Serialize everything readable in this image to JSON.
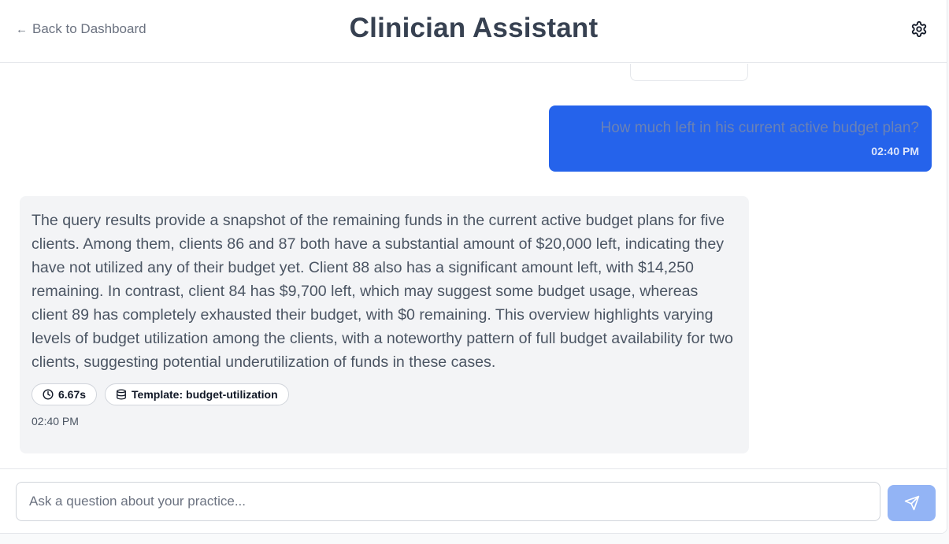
{
  "header": {
    "back_label": "Back to Dashboard",
    "back_arrow": "←",
    "title": "Clinician Assistant",
    "settings_icon": "gear-icon"
  },
  "messages": [
    {
      "role": "user",
      "text": "How much left in his current active budget plan?",
      "time": "02:40 PM"
    },
    {
      "role": "assistant",
      "text": "The query results provide a snapshot of the remaining funds in the current active budget plans for five clients. Among them, clients 86 and 87 both have a substantial amount of $20,000 left, indicating they have not utilized any of their budget yet. Client 88 also has a significant amount left, with $14,250 remaining. In contrast, client 84 has $9,700 left, which may suggest some budget usage, whereas client 89 has completely exhausted their budget, with $0 remaining. This overview highlights varying levels of budget utilization among the clients, with a noteworthy pattern of full budget availability for two clients, suggesting potential underutilization of funds in these cases.",
      "duration": "6.67s",
      "template": "Template: budget-utilization",
      "time": "02:40 PM"
    }
  ],
  "composer": {
    "placeholder": "Ask a question about your practice...",
    "value": "",
    "send_icon": "send-icon"
  },
  "colors": {
    "user_bubble": "#2563eb",
    "assistant_bubble": "#f3f4f6",
    "send_button": "#93b4f5"
  }
}
